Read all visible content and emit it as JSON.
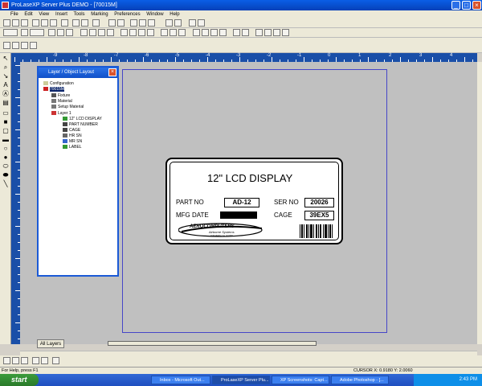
{
  "window": {
    "title": "ProLaseXP Server Plus DEMO - [70015M]"
  },
  "menu": [
    "File",
    "Edit",
    "View",
    "Insert",
    "Tools",
    "Marking",
    "Preferences",
    "Window",
    "Help"
  ],
  "ruler": {
    "top_numbers": [
      "-9",
      "-8",
      "-7",
      "-6",
      "-5",
      "-4",
      "-3",
      "-2",
      "-1",
      "0",
      "1",
      "2",
      "3",
      "4",
      "5",
      "6"
    ]
  },
  "layer_panel": {
    "title": "Layer / Object Layout",
    "tree": [
      {
        "label": "Configuration"
      },
      {
        "label": "70015M"
      },
      {
        "label": "Fixture"
      },
      {
        "label": "Material"
      },
      {
        "label": "Setup Material"
      },
      {
        "label": "Layer 1"
      },
      {
        "label": "12\" LCD DISPLAY"
      },
      {
        "label": "PART NUMBER"
      },
      {
        "label": "CAGE"
      },
      {
        "label": "HR SN"
      },
      {
        "label": "MR SN"
      },
      {
        "label": "LABEL"
      }
    ]
  },
  "label": {
    "title": "12\" LCD DISPLAY",
    "part_no_label": "PART NO",
    "part_no_value": "AD-12",
    "ser_no_label": "SER NO",
    "ser_no_value": "20026",
    "mfg_date_label": "MFG DATE",
    "cage_label": "CAGE",
    "cage_value": "39EX5",
    "logo_main": "AEROCOMPUTERS",
    "logo_sub": "Airborne Systems",
    "logo_loc": "OXNARD CA, 93030"
  },
  "all_layers_tab": "All Layers",
  "status": {
    "help": "For Help, press F1",
    "cursor": "CURSOR X: 0.9180  Y: 2.0060"
  },
  "taskbar": {
    "start": "start",
    "tasks": [
      "Inbox - Microsoft Out...",
      "ProLaseXP Server Plu...",
      "XP Screenshots: Capt...",
      "Adobe Photoshop - [..."
    ],
    "clock": "2:43 PM"
  }
}
